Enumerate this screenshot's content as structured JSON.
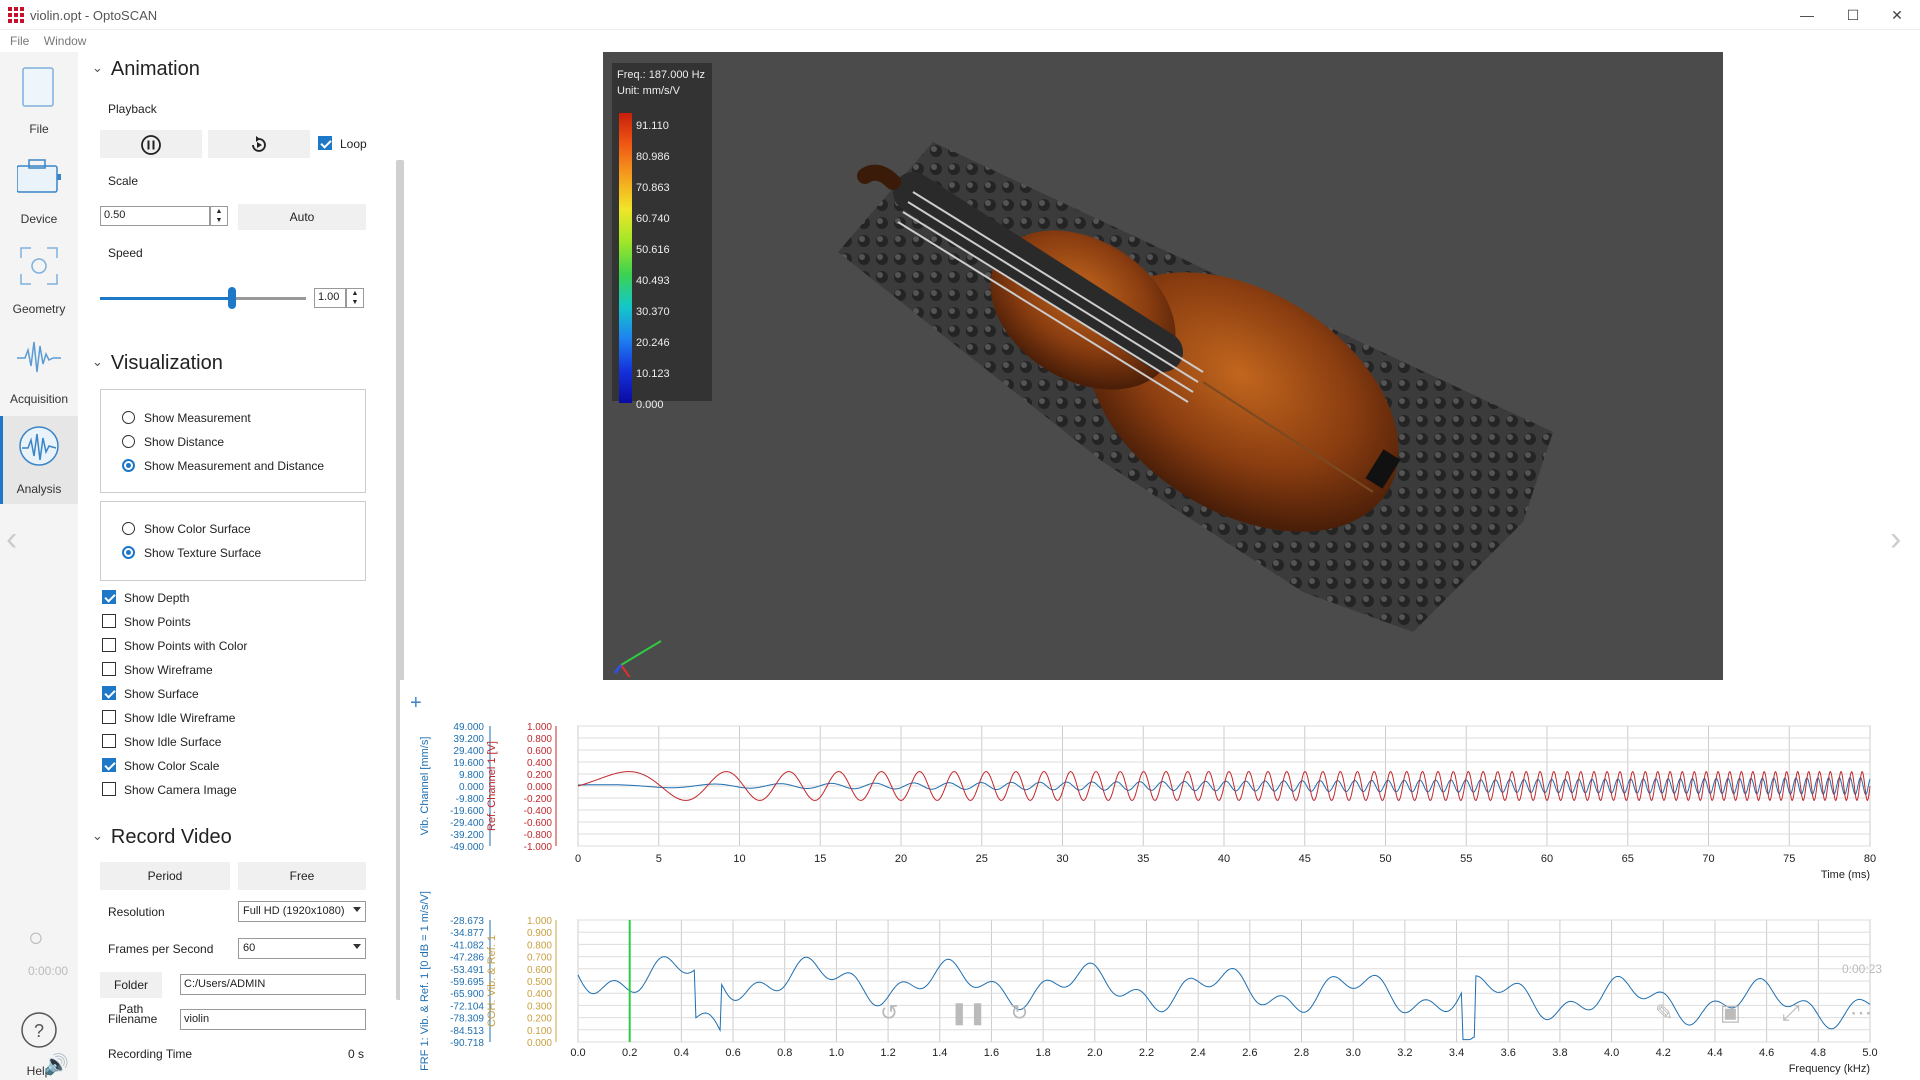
{
  "window": {
    "title": "violin.opt - OptoSCAN"
  },
  "menu": [
    "File",
    "Window"
  ],
  "nav": [
    {
      "label": "File",
      "icon": "file-icon"
    },
    {
      "label": "Device",
      "icon": "device-icon"
    },
    {
      "label": "Geometry",
      "icon": "geometry-icon"
    },
    {
      "label": "Acquisition",
      "icon": "acquisition-icon"
    },
    {
      "label": "Analysis",
      "icon": "analysis-icon",
      "active": true
    }
  ],
  "help_label": "Help",
  "animation": {
    "title": "Animation",
    "playback_label": "Playback",
    "loop_label": "Loop",
    "loop_checked": true,
    "scale_label": "Scale",
    "scale_value": "0.50",
    "auto_label": "Auto",
    "speed_label": "Speed",
    "speed_value": "1.00"
  },
  "visualization": {
    "title": "Visualization",
    "mode_options": [
      "Show Measurement",
      "Show Distance",
      "Show Measurement and Distance"
    ],
    "mode_selected": 2,
    "surface_options": [
      "Show Color Surface",
      "Show Texture Surface"
    ],
    "surface_selected": 1,
    "checks": [
      {
        "label": "Show Depth",
        "checked": true
      },
      {
        "label": "Show Points",
        "checked": false
      },
      {
        "label": "Show Points with Color",
        "checked": false
      },
      {
        "label": "Show Wireframe",
        "checked": false
      },
      {
        "label": "Show Surface",
        "checked": true
      },
      {
        "label": "Show Idle Wireframe",
        "checked": false
      },
      {
        "label": "Show Idle Surface",
        "checked": false
      },
      {
        "label": "Show Color Scale",
        "checked": true
      },
      {
        "label": "Show Camera Image",
        "checked": false
      }
    ]
  },
  "record": {
    "title": "Record Video",
    "period_label": "Period",
    "free_label": "Free",
    "resolution_label": "Resolution",
    "resolution_value": "Full HD (1920x1080)",
    "fps_label": "Frames per Second",
    "fps_value": "60",
    "folder_label": "Folder Path",
    "folder_value": "C:/Users/ADMIN",
    "filename_label": "Filename",
    "filename_value": "violin",
    "rec_time_label": "Recording Time",
    "rec_time_value": "0 s"
  },
  "colorscale": {
    "freq": "Freq.: 187.000 Hz",
    "unit": "Unit: mm/s/V",
    "ticks": [
      "91.110",
      "80.986",
      "70.863",
      "60.740",
      "50.616",
      "40.493",
      "30.370",
      "20.246",
      "10.123",
      "0.000"
    ]
  },
  "video_overlay": {
    "time_left": "0:00:00",
    "time_right": "0:00:23"
  },
  "colors": {
    "accent": "#1e78c8",
    "vib": "#1f6fb0",
    "ref": "#c0282d",
    "coh": "#c8a040"
  },
  "chart_data": [
    {
      "type": "line",
      "xlabel": "Time (ms)",
      "x_ticks": [
        "0",
        "5",
        "10",
        "15",
        "20",
        "25",
        "30",
        "35",
        "40",
        "45",
        "50",
        "55",
        "60",
        "65",
        "70",
        "75",
        "80"
      ],
      "xlim": [
        0,
        80
      ],
      "ylabel_left": "Vib. Channel [mm/s]",
      "y_ticks_left": [
        "49.000",
        "39.200",
        "29.400",
        "19.600",
        "9.800",
        "0.000",
        "-9.800",
        "-19.600",
        "-29.400",
        "-39.200",
        "-49.000"
      ],
      "ylabel_right": "Ref. Channel 1 [V]",
      "y_ticks_right": [
        "1.000",
        "0.800",
        "0.600",
        "0.400",
        "0.200",
        "0.000",
        "-0.200",
        "-0.400",
        "-0.600",
        "-0.800",
        "-1.000"
      ],
      "series": [
        {
          "name": "Vib. Channel [mm/s]",
          "description": "chirp, near zero amplitude"
        },
        {
          "name": "Ref. Channel 1 [V]",
          "description": "chirp sine ~0.2 V amplitude, increasing frequency"
        }
      ]
    },
    {
      "type": "line",
      "xlabel": "Frequency (kHz)",
      "x_ticks": [
        "0.0",
        "0.2",
        "0.4",
        "0.6",
        "0.8",
        "1.0",
        "1.2",
        "1.4",
        "1.6",
        "1.8",
        "2.0",
        "2.2",
        "2.4",
        "2.6",
        "2.8",
        "3.0",
        "3.2",
        "3.4",
        "3.6",
        "3.8",
        "4.0",
        "4.2",
        "4.4",
        "4.6",
        "4.8",
        "5.0"
      ],
      "xlim": [
        0,
        5
      ],
      "ylabel_left": "FRF 1: Vib. & Ref. 1 [0 dB = 1 m/s/V]",
      "y_ticks_left": [
        "-28.673",
        "-34.877",
        "-41.082",
        "-47.286",
        "-53.491",
        "-59.695",
        "-65.900",
        "-72.104",
        "-78.309",
        "-84.513",
        "-90.718"
      ],
      "ylabel_right": "COH: Vib. & Ref. 1",
      "y_ticks_right": [
        "1.000",
        "0.900",
        "0.800",
        "0.700",
        "0.600",
        "0.500",
        "0.400",
        "0.300",
        "0.200",
        "0.100",
        "0.000"
      ]
    }
  ]
}
